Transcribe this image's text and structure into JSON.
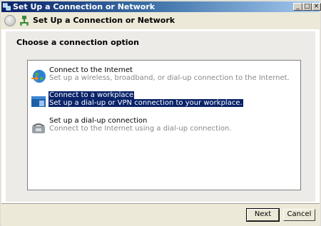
{
  "window": {
    "title": "Set Up a Connection or Network"
  },
  "nav": {
    "title": "Set Up a Connection or Network"
  },
  "main": {
    "heading": "Choose a connection option",
    "options": [
      {
        "label": "Connect to the Internet",
        "description": "Set up a wireless, broadband, or dial-up connection to the Internet.",
        "icon": "globe-icon"
      },
      {
        "label": "Connect to a workplace",
        "description": "Set up a dial-up or VPN connection to your workplace.",
        "icon": "workplace-icon",
        "selected": true
      },
      {
        "label": "Set up a dial-up connection",
        "description": "Connect to the Internet using a dial-up connection.",
        "icon": "phone-icon"
      }
    ]
  },
  "footer": {
    "next_label": "Next",
    "cancel_label": "Cancel"
  },
  "colors": {
    "selection": "#0a246a",
    "titlebar": "#0a246a"
  }
}
